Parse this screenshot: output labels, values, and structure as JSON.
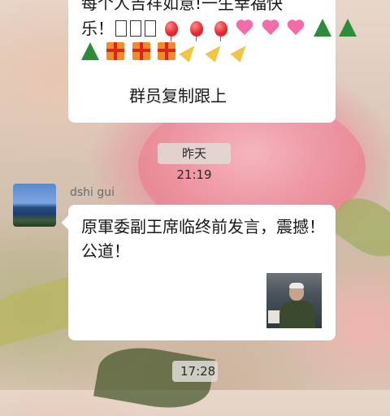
{
  "chat": {
    "top_message": {
      "line1": "每个人吉祥如意!一生幸福快",
      "line2_text": "乐！",
      "footer": "群员复制跟上",
      "emoji_row1": [
        "box-glyph",
        "box-glyph",
        "box-glyph",
        "balloon-icon",
        "balloon-icon",
        "balloon-icon",
        "gift-heart-icon",
        "gift-heart-icon",
        "gift-heart-icon",
        "christmas-tree-icon",
        "christmas-tree-icon"
      ],
      "emoji_row2": [
        "christmas-tree-icon",
        "gift-icon",
        "gift-icon",
        "gift-icon",
        "party-popper-icon",
        "party-popper-icon",
        "party-popper-icon"
      ]
    },
    "timestamp1": "昨天 21:19",
    "message2": {
      "sender": "dshi gui",
      "text": "原軍委副王席临终前发言，震撼！公道！",
      "has_video_thumbnail": true
    },
    "timestamp2": "17:28"
  },
  "colors": {
    "bubble": "#ffffff",
    "text": "#191919",
    "sender": "#6b6b6b",
    "time_pill": "#e1dcd6"
  }
}
